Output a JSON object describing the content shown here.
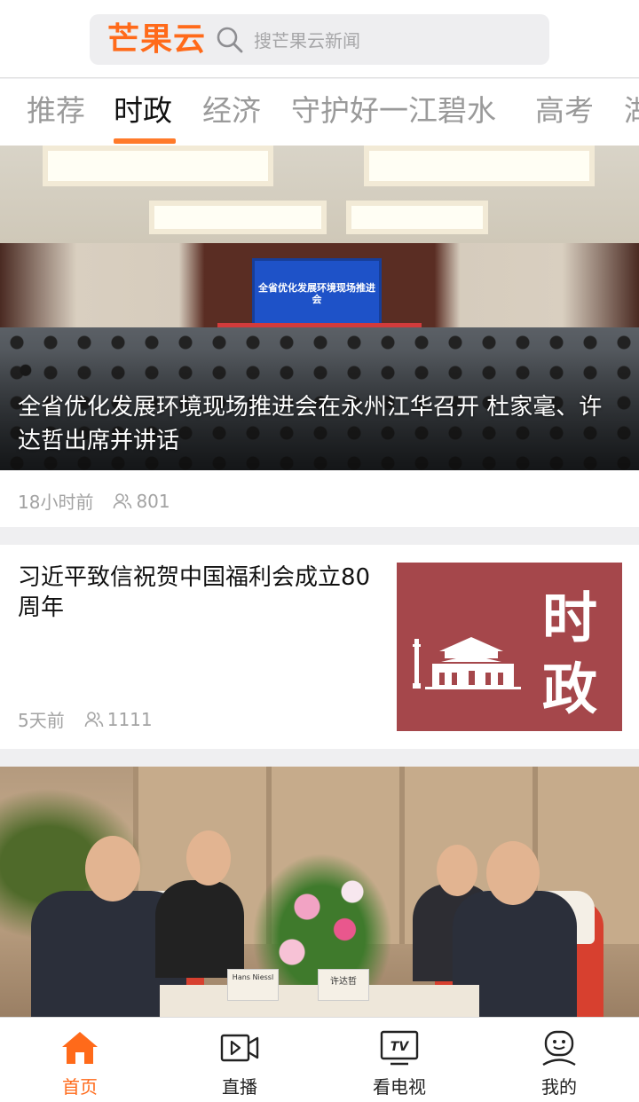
{
  "header": {
    "logo": "芒果云",
    "search_placeholder": "搜芒果云新闻",
    "accent_color": "#ff6a1a"
  },
  "tabs": [
    {
      "label": "推荐",
      "active": false
    },
    {
      "label": "时政",
      "active": true
    },
    {
      "label": "经济",
      "active": false
    },
    {
      "label": "守护好一江碧水",
      "active": false
    },
    {
      "label": "高考",
      "active": false
    },
    {
      "label": "湖",
      "active": false
    }
  ],
  "feed": {
    "items": [
      {
        "title": "全省优化发展环境现场推进会在永州江华召开 杜家毫、许达哲出席并讲话",
        "time": "18小时前",
        "views": "801",
        "image_screen_text": "全省优化发展环境现场推进会"
      },
      {
        "title": "习近平致信祝贺中国福利会成立80周年",
        "time": "5天前",
        "views": "1111",
        "thumb_text_1": "时",
        "thumb_text_2": "政"
      },
      {
        "nameplate_left": "Hans Niessl",
        "nameplate_right": "许达哲"
      }
    ]
  },
  "bottom_nav": [
    {
      "label": "首页",
      "icon": "home-icon",
      "active": true
    },
    {
      "label": "直播",
      "icon": "live-icon",
      "active": false
    },
    {
      "label": "看电视",
      "icon": "tv-icon",
      "active": false
    },
    {
      "label": "我的",
      "icon": "profile-icon",
      "active": false
    }
  ]
}
